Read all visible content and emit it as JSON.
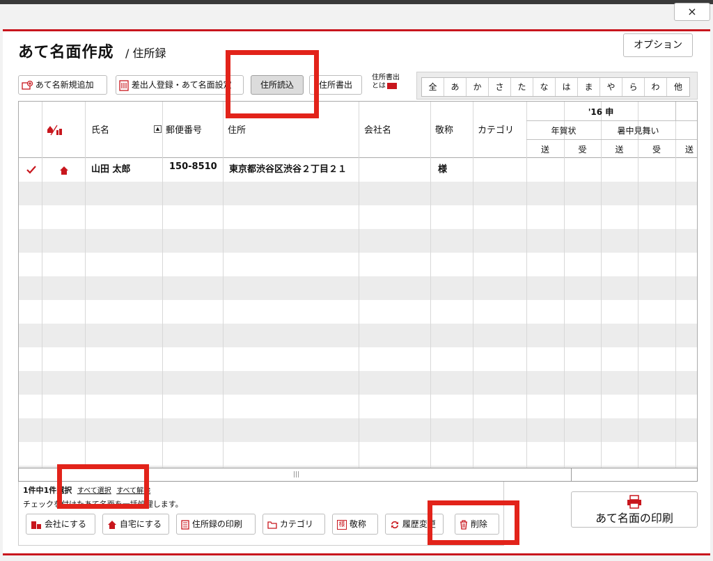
{
  "window": {
    "close_label": "×"
  },
  "header": {
    "title": "あて名面作成",
    "subtitle": "/ 住所録",
    "option_label": "オプション"
  },
  "toolbar": {
    "new_label": "あて名新規追加",
    "sender_label": "差出人登録・あて名面設定",
    "import_label": "住所読込",
    "export_label": "住所書出",
    "export_help_line1": "住所書出",
    "export_help_line2": "とは"
  },
  "kana_index": [
    "全",
    "あ",
    "か",
    "さ",
    "た",
    "な",
    "は",
    "ま",
    "や",
    "ら",
    "わ",
    "他"
  ],
  "table": {
    "columns": {
      "name": "氏名",
      "postal": "郵便番号",
      "address": "住所",
      "company": "会社名",
      "honorific": "敬称",
      "category": "カテゴリ",
      "year_group": "'16 申",
      "nenga": "年賀状",
      "shochu": "暑中見舞い",
      "send": "送",
      "recv": "受"
    },
    "rows": [
      {
        "checked": true,
        "name": "山田 太郎",
        "postal": "150-8510",
        "address": "東京都渋谷区渋谷２丁目２１",
        "company": "",
        "honorific": "様",
        "category": ""
      }
    ]
  },
  "selection": {
    "count_text": "1件中1件",
    "selected_text": "選択",
    "select_all": "すべて選択",
    "clear_all": "すべて解除",
    "hint": "チェックを付けたあて名面を一括処理します。"
  },
  "bottom_buttons": {
    "company": "会社にする",
    "home": "自宅にする",
    "print_list": "住所録の印刷",
    "category": "カテゴリ",
    "honorific": "敬称",
    "history": "履歴変更",
    "delete": "削除"
  },
  "print": {
    "label": "あて名面の印刷"
  },
  "colors": {
    "accent": "#c8161d",
    "highlight": "#e2231a"
  }
}
